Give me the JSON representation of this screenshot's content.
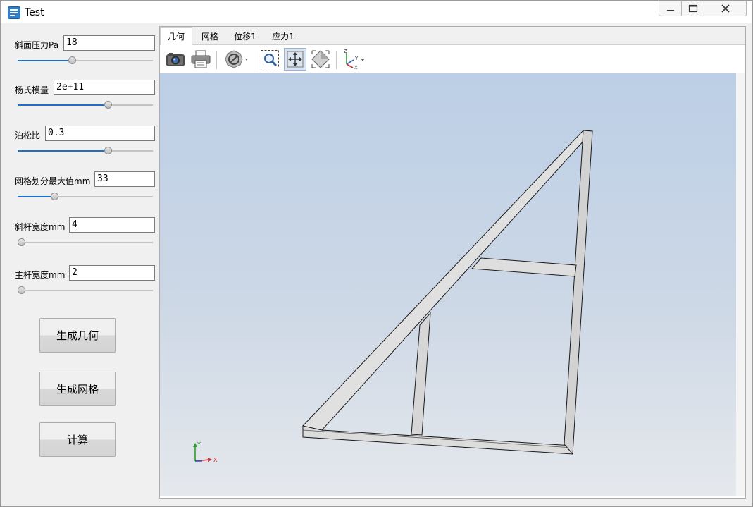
{
  "window": {
    "title": "Test"
  },
  "params": [
    {
      "label": "斜面压力Pa",
      "value": "18",
      "slider_fraction": 0.4
    },
    {
      "label": "杨氏模量",
      "value": "2e+11",
      "slider_fraction": 0.68
    },
    {
      "label": "泊松比",
      "value": "0.3",
      "slider_fraction": 0.68
    },
    {
      "label": "网格划分最大值mm",
      "value": "33",
      "slider_fraction": 0.26
    },
    {
      "label": "斜杆宽度mm",
      "value": "4",
      "slider_fraction": 0.0
    },
    {
      "label": "主杆宽度mm",
      "value": "2",
      "slider_fraction": 0.0
    }
  ],
  "buttons": {
    "generate_geometry": "生成几何",
    "generate_mesh": "生成网格",
    "compute": "计算"
  },
  "tabs": [
    {
      "label": "几何",
      "active": true
    },
    {
      "label": "网格",
      "active": false
    },
    {
      "label": "位移1",
      "active": false
    },
    {
      "label": "应力1",
      "active": false
    }
  ],
  "toolbar": {
    "icons": [
      "camera-icon",
      "print-icon",
      "no-symbol-icon",
      "zoom-box-icon",
      "fit-view-icon",
      "iso-view-icon",
      "axes-orientation-icon"
    ],
    "axes_labels": [
      "Z",
      "Y",
      "X"
    ]
  },
  "triad": {
    "labels": [
      "Y",
      "X"
    ]
  },
  "colors": {
    "slider_fill": "#1e6fc6",
    "viewport_top": "#bccfe6",
    "viewport_bottom": "#e5e8ec",
    "beam_face": "#e1e1e1",
    "beam_edge": "#1a1a1a"
  }
}
